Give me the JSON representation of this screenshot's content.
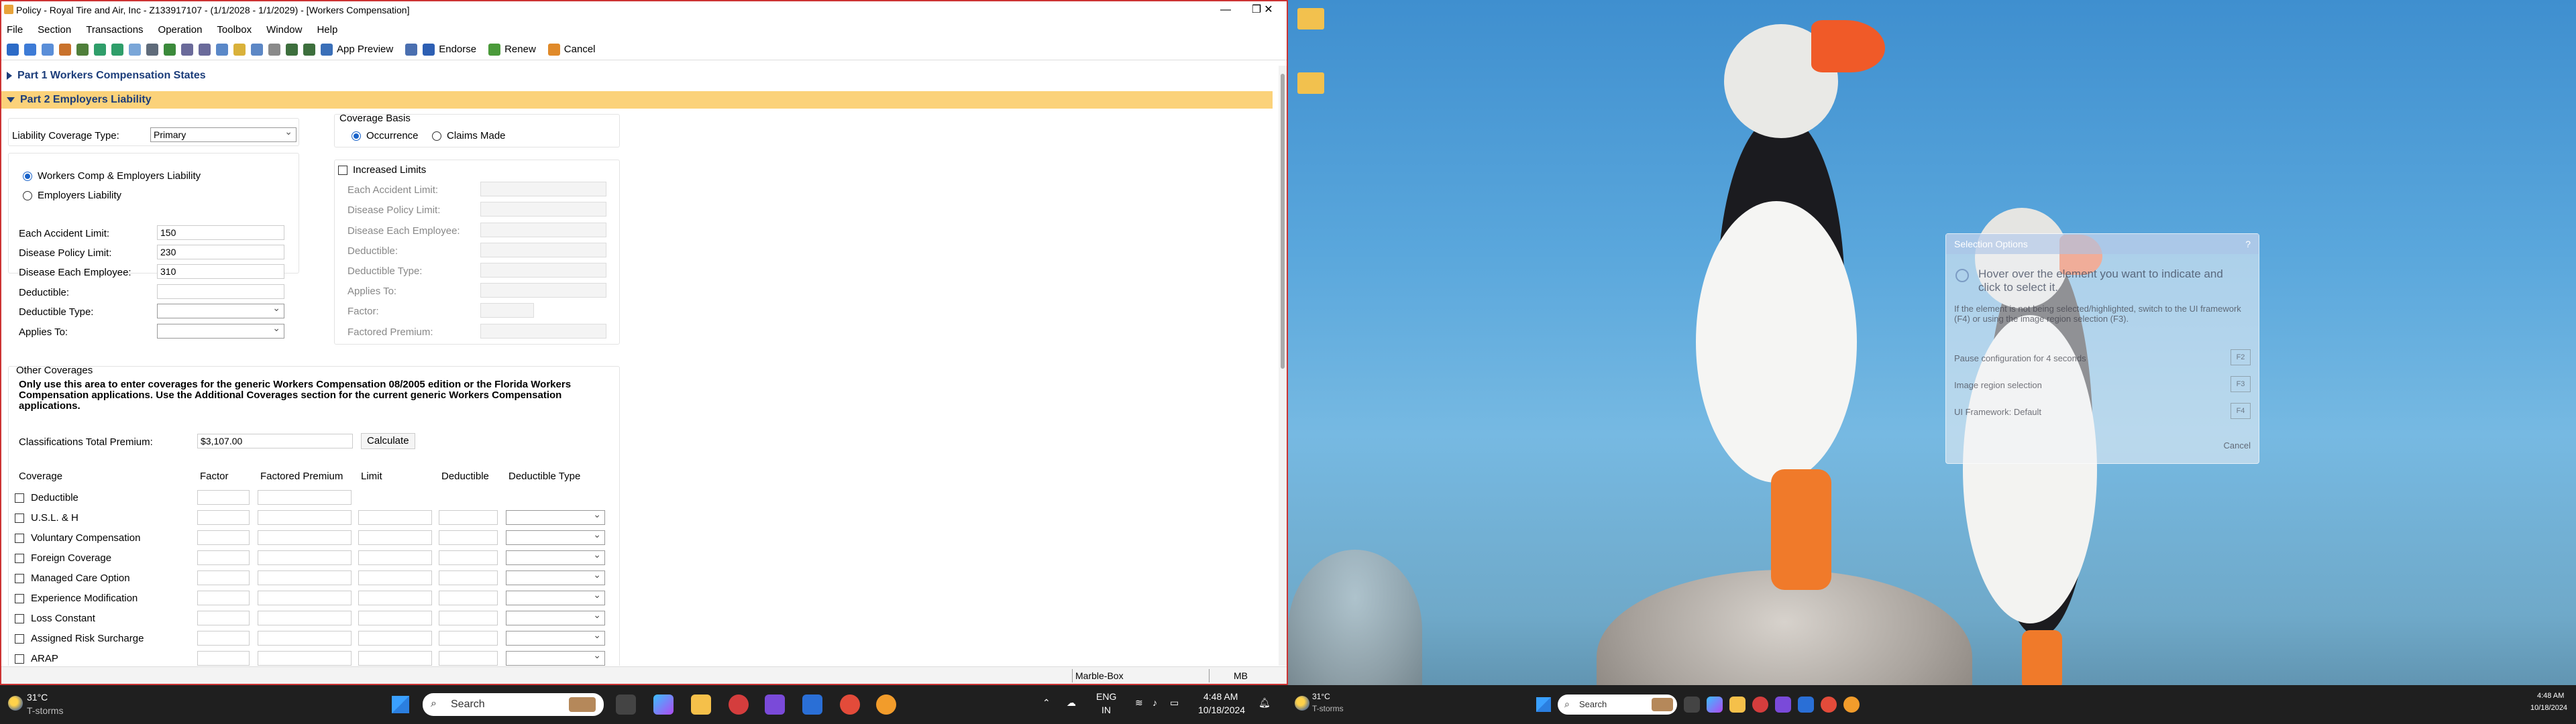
{
  "window": {
    "title": "Policy - Royal Tire and Air, Inc - Z133917107 - (1/1/2028 - 1/1/2029) - [Workers Compensation]",
    "controls": [
      "—",
      "❐",
      "✕"
    ]
  },
  "menu": [
    "File",
    "Section",
    "Transactions",
    "Operation",
    "Toolbox",
    "Window",
    "Help"
  ],
  "toolbar": {
    "app_preview": "App Preview",
    "endorse": "Endorse",
    "renew": "Renew",
    "cancel": "Cancel"
  },
  "sections": {
    "part1": "Part 1 Workers Compensation States",
    "part2": "Part 2 Employers Liability"
  },
  "form": {
    "liability_coverage_type_label": "Liability Coverage Type:",
    "liability_coverage_type_value": "Primary",
    "radio_wc_el": "Workers Comp & Employers Liability",
    "radio_el": "Employers Liability",
    "each_accident_label": "Each Accident Limit:",
    "each_accident_value": "150",
    "disease_policy_label": "Disease Policy Limit:",
    "disease_policy_value": "230",
    "disease_each_label": "Disease Each Employee:",
    "disease_each_value": "310",
    "deductible_label": "Deductible:",
    "deductible_type_label": "Deductible Type:",
    "applies_to_label": "Applies To:"
  },
  "coverage_basis": {
    "title": "Coverage Basis",
    "occurrence": "Occurrence",
    "claims_made": "Claims Made"
  },
  "increased_limits": {
    "label": "Increased Limits",
    "each_accident": "Each Accident Limit:",
    "disease_policy": "Disease Policy Limit:",
    "disease_each": "Disease Each Employee:",
    "deductible": "Deductible:",
    "deductible_type": "Deductible Type:",
    "applies_to": "Applies To:",
    "factor": "Factor:",
    "factored_premium": "Factored Premium:"
  },
  "other_coverages": {
    "title": "Other Coverages",
    "note": "Only use this area to enter coverages for the generic Workers Compensation 08/2005 edition or the Florida Workers Compensation applications.  Use the Additional Coverages section for the current generic Workers Compensation applications.",
    "total_premium_label": "Classifications Total Premium:",
    "total_premium_value": "$3,107.00",
    "calculate": "Calculate",
    "headers": [
      "Coverage",
      "Factor",
      "Factored Premium",
      "Limit",
      "Deductible",
      "Deductible Type"
    ],
    "rows": [
      "Deductible",
      "U.S.L. & H",
      "Voluntary Compensation",
      "Foreign Coverage",
      "Managed Care Option",
      "Experience Modification",
      "Loss Constant",
      "Assigned Risk Surcharge",
      "ARAP"
    ]
  },
  "statusbar": {
    "cell1": "Marble-Box",
    "cell2": "MB"
  },
  "taskbar_left": {
    "temp": "31°C",
    "cond": "T-storms",
    "search": "Search",
    "lang1": "ENG",
    "lang2": "IN",
    "time": "4:48 AM",
    "date": "10/18/2024"
  },
  "taskbar_right": {
    "temp": "31°C",
    "cond": "T-storms",
    "search": "Search",
    "time": "4:48 AM",
    "date": "10/18/2024"
  },
  "dialog": {
    "title": "Selection Options",
    "help": "?",
    "headline": "Hover over the element you want to indicate and click to select it.",
    "body": "If the element is not being selected/highlighted, switch to the UI framework (F4) or using the image region selection (F3).",
    "opt1": "Pause configuration for 4 seconds",
    "opt2": "Image region selection",
    "opt3": "UI Framework: Default",
    "k1": "F2",
    "k2": "F3",
    "k3": "F4",
    "cancel": "Cancel"
  }
}
